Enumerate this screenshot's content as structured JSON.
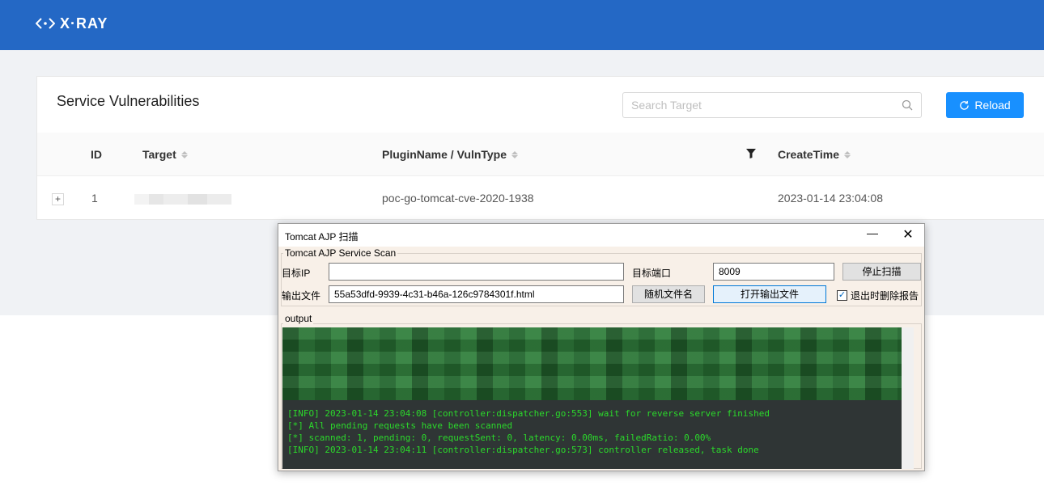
{
  "app": {
    "logo_text": "X·RAY"
  },
  "card": {
    "title": "Service Vulnerabilities",
    "search_placeholder": "Search Target",
    "reload_label": "Reload"
  },
  "table": {
    "columns": [
      "ID",
      "Target",
      "PluginName / VulnType",
      "CreateTime"
    ],
    "rows": [
      {
        "expand": "+",
        "id": "1",
        "target": "",
        "plugin": "poc-go-tomcat-cve-2020-1938",
        "create_time": "2023-01-14 23:04:08"
      }
    ]
  },
  "dialog": {
    "title": "Tomcat AJP 扫描",
    "min_glyph": "—",
    "close_glyph": "✕",
    "group_label": "Tomcat AJP Service Scan",
    "target_ip_label": "目标IP",
    "target_ip_value": "",
    "target_port_label": "目标端口",
    "target_port_value": "8009",
    "stop_button": "停止扫描",
    "output_file_label": "输出文件",
    "output_file_value": "55a53dfd-9939-4c31-b46a-126c9784301f.html",
    "random_name_button": "随机文件名",
    "open_output_button": "打开输出文件",
    "delete_on_exit_label": "退出时删除报告",
    "delete_on_exit_checked": true,
    "output_group_label": "output",
    "log_lines": [
      "[INFO] 2023-01-14 23:04:08 [controller:dispatcher.go:553] wait for reverse server finished",
      "[*] All pending requests have been scanned",
      "[*] scanned: 1, pending: 0, requestSent: 0, latency: 0.00ms, failedRatio: 0.00%",
      "[INFO] 2023-01-14 23:04:11 [controller:dispatcher.go:573] controller released, task done"
    ]
  },
  "colors": {
    "header": "#2468c5",
    "primary": "#1890ff",
    "console_bg": "#2f3535",
    "console_text": "#2bd92b"
  }
}
